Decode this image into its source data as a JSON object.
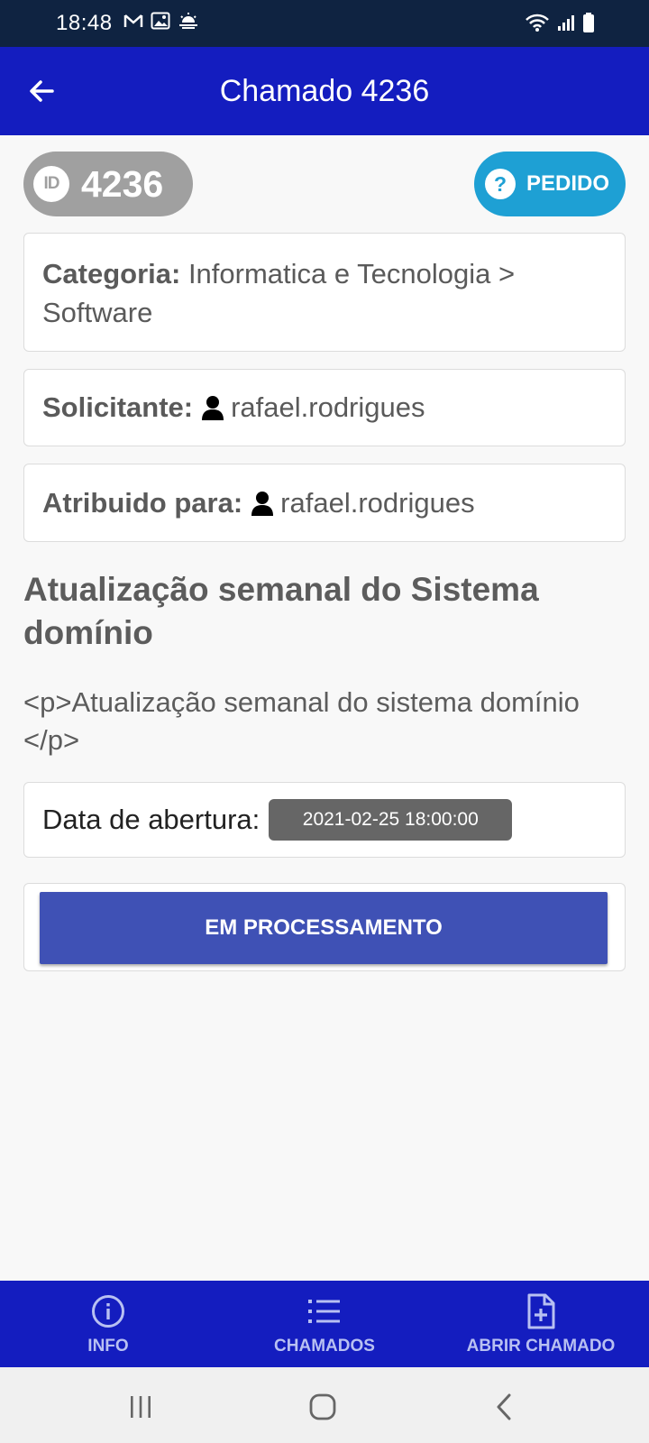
{
  "status_bar": {
    "time": "18:48"
  },
  "app_bar": {
    "title": "Chamado 4236"
  },
  "ticket": {
    "id_badge": "ID",
    "id": "4236",
    "type_icon": "?",
    "type": "PEDIDO",
    "categoria_label": "Categoria:",
    "categoria_value": "Informatica e Tecnologia > Software",
    "solicitante_label": "Solicitante:",
    "solicitante_value": "rafael.rodrigues",
    "atribuido_label": "Atribuido para:",
    "atribuido_value": "rafael.rodrigues",
    "title": "Atualização semanal do Sistema domínio",
    "description": "<p>Atualização semanal do sistema domínio </p>",
    "data_label": "Data de abertura:",
    "data_value": "2021-02-25 18:00:00",
    "status_button": "EM PROCESSAMENTO"
  },
  "bottom_nav": {
    "items": [
      {
        "label": "INFO",
        "icon": "info-icon"
      },
      {
        "label": "CHAMADOS",
        "icon": "list-icon"
      },
      {
        "label": "ABRIR CHAMADO",
        "icon": "file-plus-icon"
      }
    ]
  },
  "colors": {
    "app_bar": "#141dbf",
    "status_bar": "#0f2341",
    "type_pill": "#1ea0d4",
    "id_pill": "#a0a0a0",
    "status_button": "#3f51b5"
  }
}
